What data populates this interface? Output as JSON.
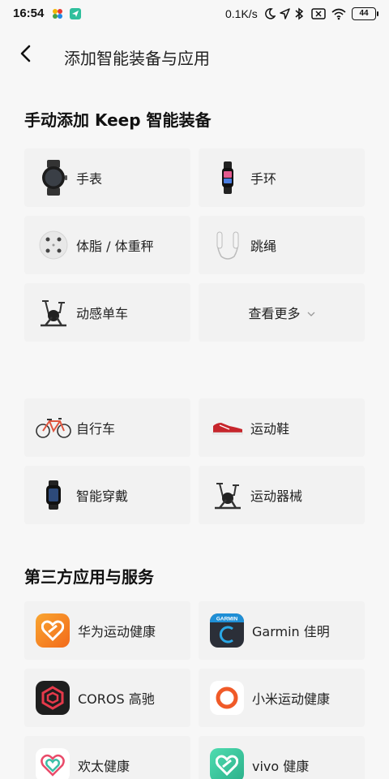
{
  "status_bar": {
    "time": "16:54",
    "network_speed": "0.1K/s",
    "battery": "44",
    "icons": [
      "pinwheel-app-icon",
      "send-app-icon",
      "moon-icon",
      "location-arrow-icon",
      "bluetooth-icon",
      "sim-off-icon",
      "wifi-icon",
      "battery-icon"
    ]
  },
  "header": {
    "title": "添加智能装备与应用",
    "back_icon": "chevron-left-icon"
  },
  "manual_section": {
    "title": "手动添加 Keep 智能装备",
    "items": [
      {
        "label": "手表",
        "icon": "smartwatch-icon"
      },
      {
        "label": "手环",
        "icon": "fitness-band-icon"
      },
      {
        "label": "体脂 / 体重秤",
        "icon": "scale-icon"
      },
      {
        "label": "跳绳",
        "icon": "jump-rope-icon"
      },
      {
        "label": "动感单车",
        "icon": "spin-bike-icon"
      },
      {
        "label": "查看更多",
        "icon": "chevron-down-icon"
      }
    ]
  },
  "other_devices": {
    "items": [
      {
        "label": "自行车",
        "icon": "bicycle-icon"
      },
      {
        "label": "运动鞋",
        "icon": "sneaker-icon"
      },
      {
        "label": "智能穿戴",
        "icon": "wearable-icon"
      },
      {
        "label": "运动器械",
        "icon": "exercise-machine-icon"
      }
    ]
  },
  "third_party_section": {
    "title": "第三方应用与服务",
    "items": [
      {
        "label": "华为运动健康",
        "icon": "huawei-health-icon",
        "color": "#f7931e"
      },
      {
        "label": "Garmin 佳明",
        "icon": "garmin-icon",
        "color": "#2b2f38"
      },
      {
        "label": "COROS 高驰",
        "icon": "coros-icon",
        "color": "#1e1e1e"
      },
      {
        "label": "小米运动健康",
        "icon": "xiaomi-health-icon",
        "color": "#f05a28"
      },
      {
        "label": "欢太健康",
        "icon": "heytap-health-icon",
        "color": "#e94b6a"
      },
      {
        "label": "vivo 健康",
        "icon": "vivo-health-icon",
        "color": "#3cc9a0"
      }
    ]
  }
}
